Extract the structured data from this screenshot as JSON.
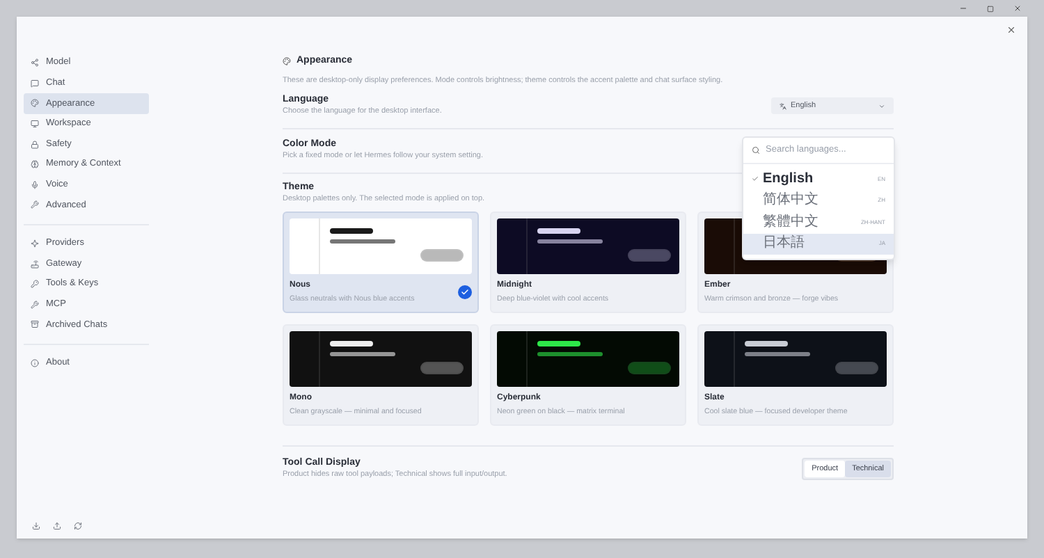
{
  "sidebar": {
    "groups": [
      {
        "items": [
          {
            "label": "Model",
            "selected": false
          },
          {
            "label": "Chat",
            "selected": false
          },
          {
            "label": "Appearance",
            "selected": true
          },
          {
            "label": "Workspace",
            "selected": false
          },
          {
            "label": "Safety",
            "selected": false
          },
          {
            "label": "Memory & Context",
            "selected": false
          },
          {
            "label": "Voice",
            "selected": false
          },
          {
            "label": "Advanced",
            "selected": false
          }
        ]
      },
      {
        "items": [
          {
            "label": "Providers",
            "selected": false
          },
          {
            "label": "Gateway",
            "selected": false
          },
          {
            "label": "Tools & Keys",
            "selected": false
          },
          {
            "label": "MCP",
            "selected": false
          },
          {
            "label": "Archived Chats",
            "selected": false
          }
        ]
      },
      {
        "items": [
          {
            "label": "About",
            "selected": false
          }
        ]
      }
    ]
  },
  "section": {
    "title": "Appearance",
    "description": "These are desktop-only display preferences. Mode controls brightness; theme controls the accent palette and chat surface styling."
  },
  "language": {
    "title": "Language",
    "description": "Choose the language for the desktop interface.",
    "value": "English",
    "search_placeholder": "Search languages...",
    "options": [
      {
        "label": "English",
        "code": "EN",
        "selected": true,
        "hovered": false
      },
      {
        "label": "简体中文",
        "code": "ZH",
        "selected": false,
        "hovered": false
      },
      {
        "label": "繁體中文",
        "code": "ZH-HANT",
        "selected": false,
        "hovered": false
      },
      {
        "label": "日本語",
        "code": "JA",
        "selected": false,
        "hovered": true
      }
    ]
  },
  "color_mode": {
    "title": "Color Mode",
    "description": "Pick a fixed mode or let Hermes follow your system setting."
  },
  "theme": {
    "title": "Theme",
    "description": "Desktop palettes only. The selected mode is applied on top.",
    "themes": [
      {
        "name": "Nous",
        "description": "Glass neutrals with Nous blue accents",
        "selected": true,
        "color": "#ffffff"
      },
      {
        "name": "Midnight",
        "description": "Deep blue-violet with cool accents",
        "selected": false,
        "color": "#0d0b24"
      },
      {
        "name": "Ember",
        "description": "Warm crimson and bronze — forge vibes",
        "selected": false,
        "color": "#1a0c06"
      },
      {
        "name": "Mono",
        "description": "Clean grayscale — minimal and focused",
        "selected": false,
        "color": "#111111"
      },
      {
        "name": "Cyberpunk",
        "description": "Neon green on black — matrix terminal",
        "selected": false,
        "color": "#030a03"
      },
      {
        "name": "Slate",
        "description": "Cool slate blue — focused developer theme",
        "selected": false,
        "color": "#0d1118"
      }
    ]
  },
  "tool_call_display": {
    "title": "Tool Call Display",
    "description": "Product hides raw tool payloads; Technical shows full input/output.",
    "options": [
      {
        "label": "Product",
        "selected": false
      },
      {
        "label": "Technical",
        "selected": true
      }
    ]
  }
}
